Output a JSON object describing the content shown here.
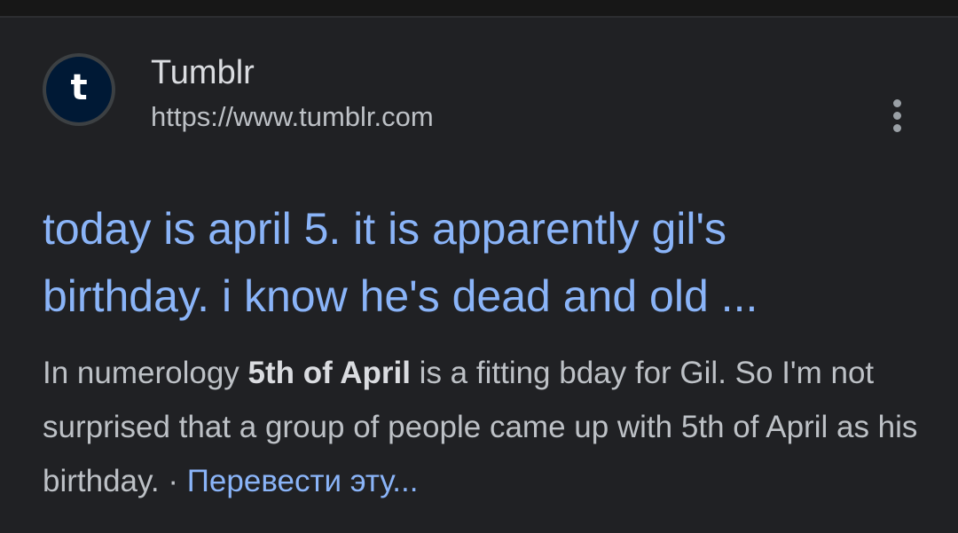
{
  "result": {
    "site_name": "Tumblr",
    "site_url": "https://www.tumblr.com",
    "favicon_letter": "t",
    "favicon_icon": "tumblr-logo-icon",
    "more_icon": "more-vertical-icon",
    "title_line1": "today is april 5. it is apparently gil's",
    "title_line2": "birthday. i know he's dead and old ...",
    "snippet": {
      "before_bold": "In numerology ",
      "bold": "5th of April",
      "after_bold": " is a fitting bday for Gil. So I'm not surprised that a group of people came up with 5th of April as his birthday.",
      "separator": " · ",
      "translate_link": "Перевести эту..."
    }
  },
  "colors": {
    "background": "#202124",
    "link_blue": "#8ab4f8",
    "text_primary": "#dadce0",
    "text_secondary": "#bdc1c6",
    "favicon_bg": "#001935"
  }
}
